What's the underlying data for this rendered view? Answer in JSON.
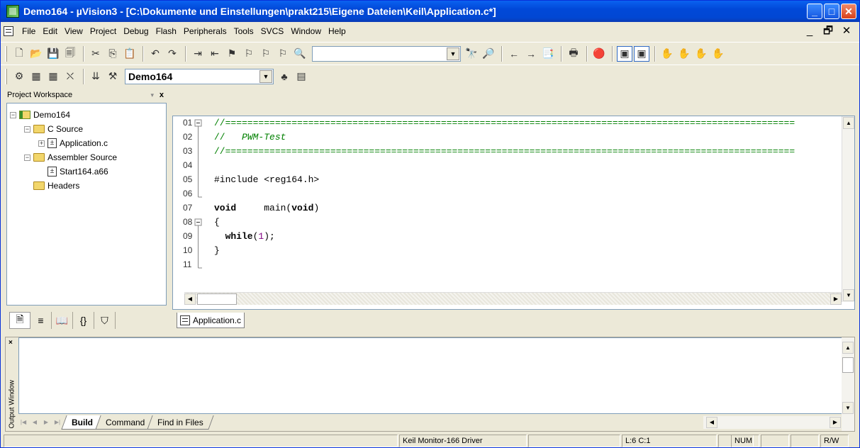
{
  "window": {
    "title": "Demo164 - µVision3 - [C:\\Dokumente und Einstellungen\\prakt215\\Eigene Dateien\\Keil\\Application.c*]",
    "minimize": "_",
    "maximize": "□",
    "close": "✕"
  },
  "menu": {
    "items": [
      "File",
      "Edit",
      "View",
      "Project",
      "Debug",
      "Flash",
      "Peripherals",
      "Tools",
      "SVCS",
      "Window",
      "Help"
    ],
    "mdi_min": "_",
    "mdi_restore": "🗗",
    "mdi_close": "✕"
  },
  "toolbar2": {
    "target": "Demo164"
  },
  "workspace": {
    "title": "Project Workspace",
    "dropdown": "▾",
    "close": "x",
    "tree": [
      {
        "label": "Demo164",
        "level": 0,
        "pm": "−",
        "type": "root"
      },
      {
        "label": "C Source",
        "level": 1,
        "pm": "−",
        "type": "folder"
      },
      {
        "label": "Application.c",
        "level": 2,
        "pm": "+",
        "type": "file"
      },
      {
        "label": "Assembler Source",
        "level": 1,
        "pm": "−",
        "type": "folder"
      },
      {
        "label": "Start164.a66",
        "level": 2,
        "pm": "",
        "type": "file"
      },
      {
        "label": "Headers",
        "level": 1,
        "pm": "",
        "type": "folder"
      }
    ]
  },
  "editor": {
    "line_numbers": [
      "01",
      "02",
      "03",
      "04",
      "05",
      "06",
      "07",
      "08",
      "09",
      "10",
      "11"
    ],
    "lines": {
      "l01": "//=======================================================================================================",
      "l02a": "//   ",
      "l02b": "PWM-Test",
      "l03": "//=======================================================================================================",
      "l04": "",
      "l05": "#include <reg164.h>",
      "l06": "",
      "l07a": "void",
      "l07b": "     main(",
      "l07c": "void",
      "l07d": ")",
      "l08": "{",
      "l09a": "  while",
      "l09b": "(",
      "l09c": "1",
      "l09d": ");",
      "l10": "}",
      "l11": ""
    },
    "tab_label": "Application.c"
  },
  "output": {
    "title": "Output Window",
    "close": "×",
    "tabs": [
      "Build",
      "Command",
      "Find in Files"
    ]
  },
  "status": {
    "driver": "Keil Monitor-166 Driver",
    "position": "L:6 C:1",
    "num": "NUM",
    "rw": "R/W"
  }
}
